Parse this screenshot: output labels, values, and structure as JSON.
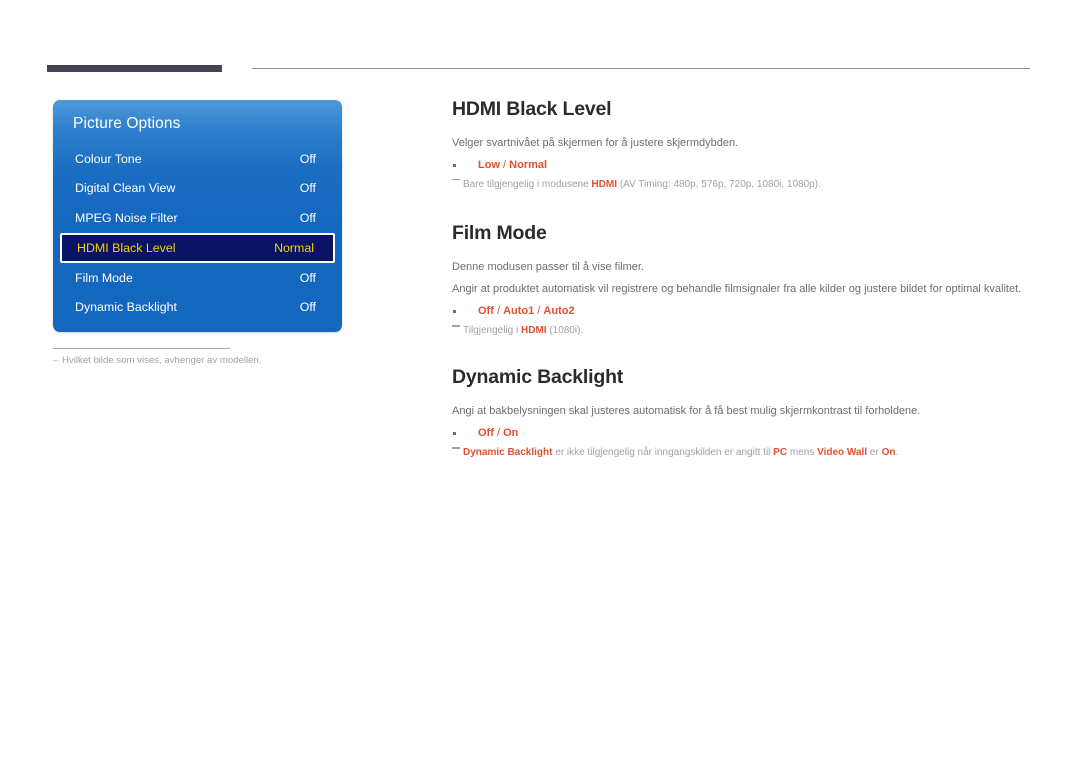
{
  "header": {
    "left_bar": "",
    "rule": ""
  },
  "osd_menu": {
    "title": "Picture Options",
    "rows": [
      {
        "label": "Colour Tone",
        "value": "Off",
        "selected": false
      },
      {
        "label": "Digital Clean View",
        "value": "Off",
        "selected": false
      },
      {
        "label": "MPEG Noise Filter",
        "value": "Off",
        "selected": false
      },
      {
        "label": "HDMI Black Level",
        "value": "Normal",
        "selected": true
      },
      {
        "label": "Film Mode",
        "value": "Off",
        "selected": false
      },
      {
        "label": "Dynamic Backlight",
        "value": "Off",
        "selected": false
      }
    ],
    "footnote": {
      "dash": "–",
      "text": "Hvilket bilde som vises, avhenger av modellen."
    },
    "colors": {
      "panel_blue": "#1467bf",
      "selected_fill": "#0b1464",
      "selected_text": "#f5d000"
    }
  },
  "sections": [
    {
      "heading": "HDMI Black Level",
      "paragraphs": [
        "Velger svartnivået på skjermen for å justere skjermdybden."
      ],
      "options": [
        "Low",
        "Normal"
      ],
      "note": {
        "parts": [
          {
            "text": "Bare tilgjengelig i modusene ",
            "bold": false
          },
          {
            "text": "HDMI",
            "bold": true
          },
          {
            "text": " (AV Timing: 480p, 576p, 720p, 1080i, 1080p).",
            "bold": false
          }
        ]
      }
    },
    {
      "heading": "Film Mode",
      "paragraphs": [
        "Denne modusen passer til å vise filmer.",
        "Angir at produktet automatisk vil registrere og behandle filmsignaler fra alle kilder og justere bildet for optimal kvalitet."
      ],
      "options": [
        "Off",
        "Auto1",
        "Auto2"
      ],
      "note": {
        "parts": [
          {
            "text": "Tilgjengelig i ",
            "bold": false
          },
          {
            "text": "HDMI",
            "bold": true
          },
          {
            "text": " (1080i).",
            "bold": false
          }
        ]
      }
    },
    {
      "heading": "Dynamic Backlight",
      "paragraphs": [
        "Angi at bakbelysningen skal justeres automatisk for å få best mulig skjermkontrast til forholdene."
      ],
      "options": [
        "Off",
        "On"
      ],
      "note": {
        "parts": [
          {
            "text": "Dynamic Backlight",
            "bold": true
          },
          {
            "text": " er ikke tilgjengelig når inngangskilden er angitt til ",
            "bold": false
          },
          {
            "text": "PC",
            "bold": true
          },
          {
            "text": " mens ",
            "bold": false
          },
          {
            "text": "Video Wall",
            "bold": true
          },
          {
            "text": " er ",
            "bold": false
          },
          {
            "text": "On",
            "bold": true
          },
          {
            "text": ".",
            "bold": false
          }
        ]
      }
    }
  ],
  "accent": {
    "orange": "#e0512f",
    "gray_text": "#6d6d72",
    "note_gray": "#a0a0a8"
  }
}
